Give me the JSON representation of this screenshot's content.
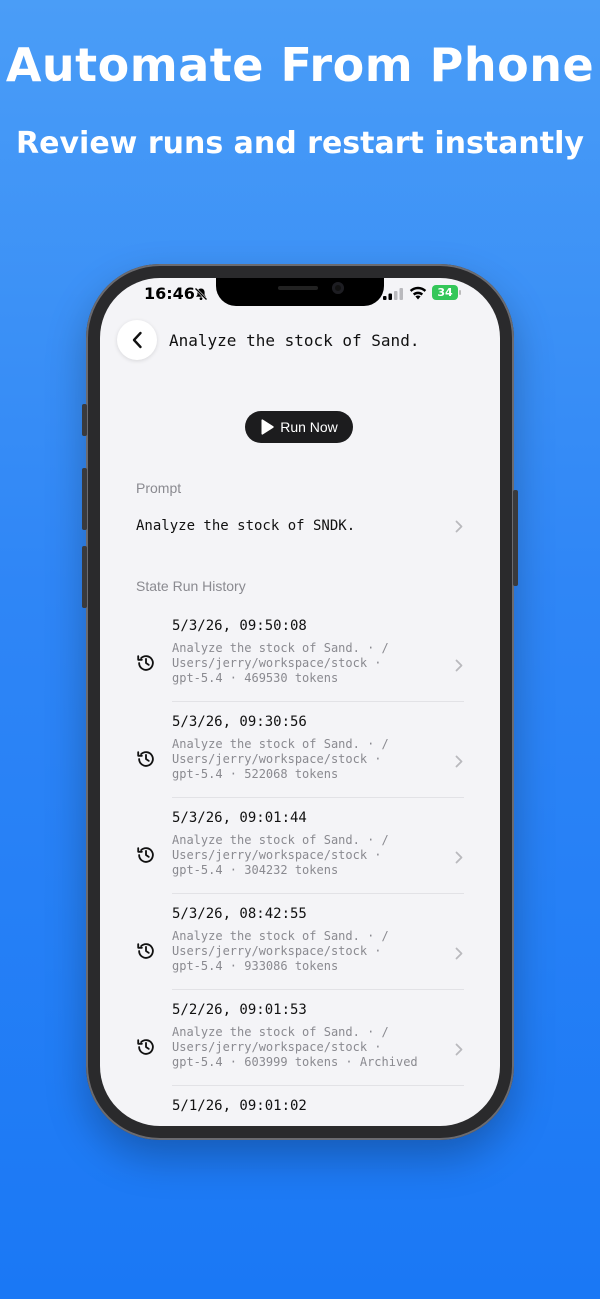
{
  "promo": {
    "headline": "Automate From Phone",
    "subhead": "Review runs and restart instantly"
  },
  "status_bar": {
    "time": "16:46",
    "battery": "34"
  },
  "nav": {
    "title": "Analyze the stock of Sand."
  },
  "run_button": {
    "label": "Run Now"
  },
  "prompt_section": {
    "label": "Prompt",
    "text": "Analyze the stock of SNDK."
  },
  "history_section": {
    "label": "State Run History",
    "runs": [
      {
        "date": "5/3/26, 09:50:08",
        "line1": "Analyze the stock of Sand. · /",
        "line2": "Users/jerry/workspace/stock ·",
        "line3": "gpt-5.4 · 469530 tokens"
      },
      {
        "date": "5/3/26, 09:30:56",
        "line1": "Analyze the stock of Sand. · /",
        "line2": "Users/jerry/workspace/stock ·",
        "line3": "gpt-5.4 · 522068 tokens"
      },
      {
        "date": "5/3/26, 09:01:44",
        "line1": "Analyze the stock of Sand. · /",
        "line2": "Users/jerry/workspace/stock ·",
        "line3": "gpt-5.4 · 304232 tokens"
      },
      {
        "date": "5/3/26, 08:42:55",
        "line1": "Analyze the stock of Sand. · /",
        "line2": "Users/jerry/workspace/stock ·",
        "line3": "gpt-5.4 · 933086 tokens"
      },
      {
        "date": "5/2/26, 09:01:53",
        "line1": "Analyze the stock of Sand. · /",
        "line2": "Users/jerry/workspace/stock ·",
        "line3": "gpt-5.4 · 603999 tokens · Archived"
      },
      {
        "date": "5/1/26, 09:01:02"
      }
    ]
  }
}
